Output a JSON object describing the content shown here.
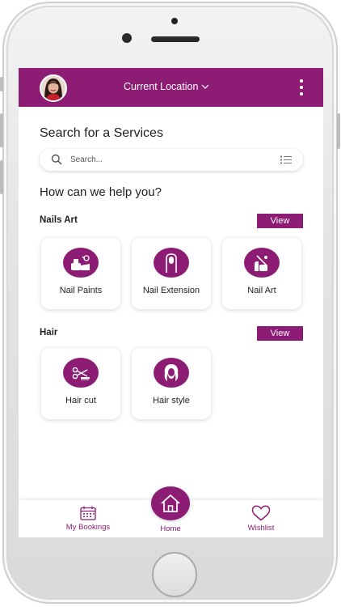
{
  "header": {
    "location_label": "Current Location",
    "colors": {
      "primary": "#8c1c74"
    }
  },
  "search": {
    "heading": "Search for a Services",
    "placeholder": "Search..."
  },
  "help": {
    "heading": "How can we help you?"
  },
  "sections": [
    {
      "title": "Nails Art",
      "view_label": "View",
      "items": [
        {
          "label": "Nail Paints",
          "icon": "nail-paint-icon"
        },
        {
          "label": "Nail Extension",
          "icon": "nail-extension-icon"
        },
        {
          "label": "Nail Art",
          "icon": "nail-art-icon"
        }
      ]
    },
    {
      "title": "Hair",
      "view_label": "View",
      "items": [
        {
          "label": "Hair cut",
          "icon": "scissors-comb-icon"
        },
        {
          "label": "Hair style",
          "icon": "hair-style-icon"
        }
      ]
    }
  ],
  "bottom_nav": {
    "bookings_label": "My Bookings",
    "home_label": "Home",
    "wishlist_label": "Wishlist"
  }
}
